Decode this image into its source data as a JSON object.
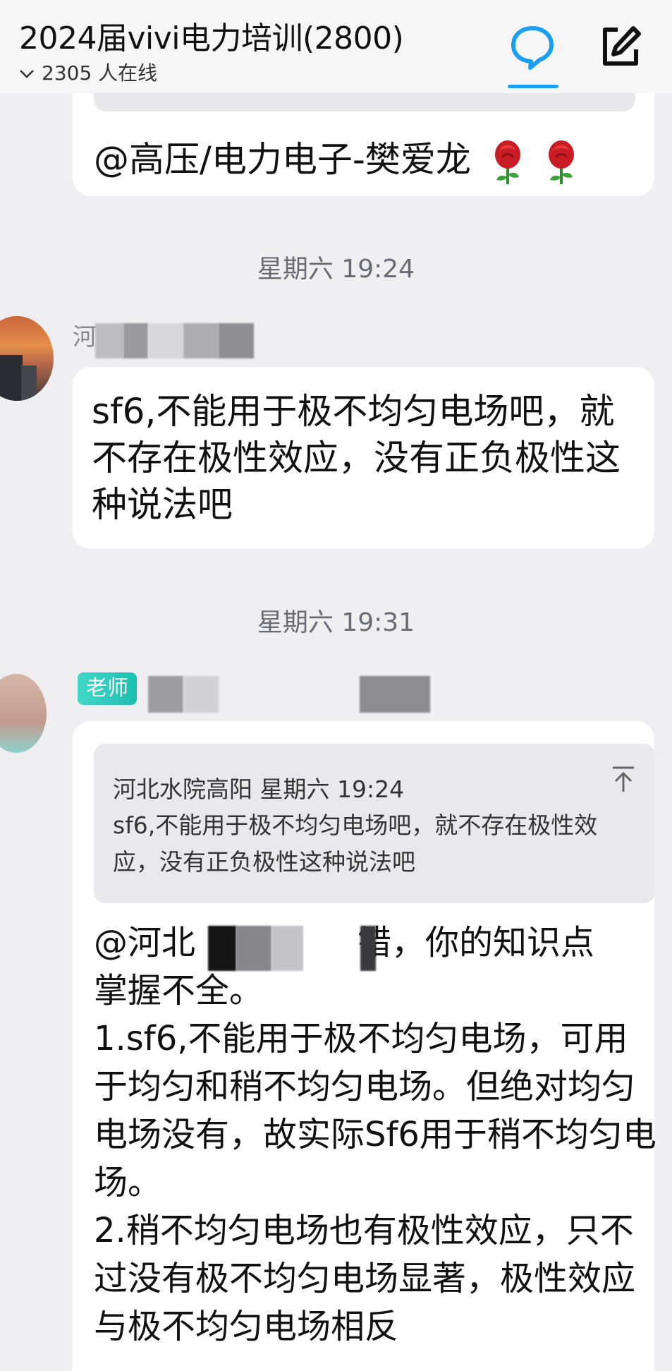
{
  "header": {
    "title": "2024届vivi电力培训(2800)",
    "online_count": "2305 人在线",
    "chat_icon": "chat-bubble-icon",
    "edit_icon": "edit-icon",
    "accent_color": "#1a9ff2"
  },
  "messages": {
    "first_partial": {
      "mention": "@高压/电力电子-樊爱龙",
      "emoji": "rose"
    },
    "timestamp1": "星期六 19:24",
    "msg1": {
      "sender_visible": "河",
      "text": "sf6,不能用于极不均匀电场吧，就不存在极性效应，没有正负极性这种说法吧"
    },
    "timestamp2": "星期六 19:31",
    "msg2": {
      "badge": "老师",
      "quote_header": "河北水院高阳 星期六 19:24",
      "quote_text": "sf6,不能用于极不均匀电场吧，就不存在极性效应，没有正负极性这种说法吧",
      "mention_start": "@河北",
      "mention_end": "错，你的知识点",
      "body_rest": "掌握不全。\n1.sf6,不能用于极不均匀电场，可用于均匀和稍不均匀电场。但绝对均匀电场没有，故实际Sf6用于稍不均匀电场。\n2.稍不均匀电场也有极性效应，只不过没有极不均匀电场显著，极性效应与极不均匀电场相反"
    }
  }
}
